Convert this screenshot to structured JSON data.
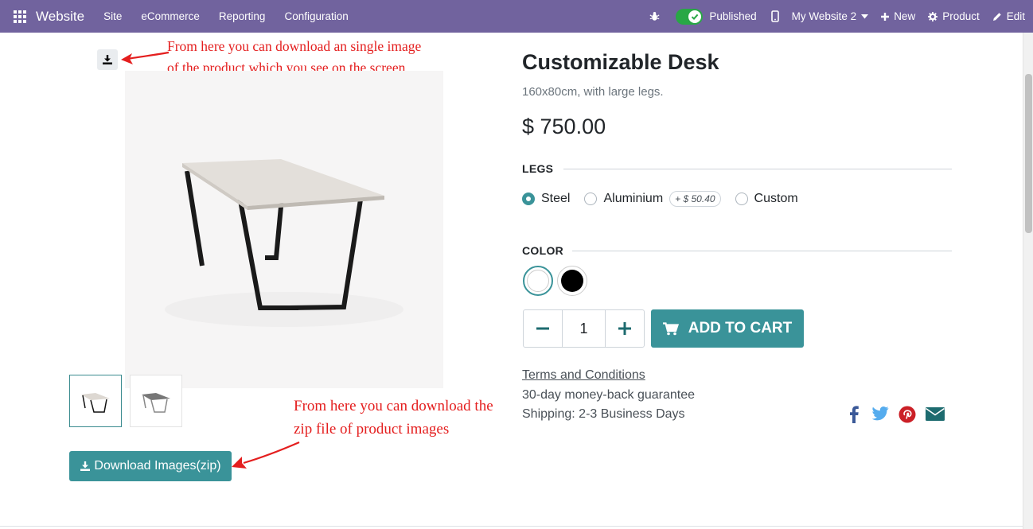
{
  "navbar": {
    "brand": "Website",
    "menu": [
      "Site",
      "eCommerce",
      "Reporting",
      "Configuration"
    ],
    "published_label": "Published",
    "website_selector": "My Website 2",
    "new_label": "New",
    "product_label": "Product",
    "edit_label": "Edit"
  },
  "annotations": {
    "single_download_line1": "From here you can download an single image",
    "single_download_line2": "of the product which you see on the screen",
    "zip_download_line1": "From here you can download the",
    "zip_download_line2": "zip file of product images"
  },
  "left": {
    "zip_button_label": "Download Images(zip)"
  },
  "product": {
    "name": "Customizable Desk",
    "description": "160x80cm, with large legs.",
    "price": "$ 750.00",
    "legs_label": "LEGS",
    "legs_options": [
      "Steel",
      "Aluminium",
      "Custom"
    ],
    "legs_selected": "Steel",
    "aluminium_extra": "+ $ 50.40",
    "color_label": "COLOR",
    "colors": [
      "#ffffff",
      "#000000"
    ],
    "selected_color": "#ffffff",
    "quantity": "1",
    "add_to_cart_label": "ADD TO CART",
    "terms_label": "Terms and Conditions",
    "guarantee": "30-day money-back guarantee",
    "shipping": "Shipping: 2-3 Business Days"
  },
  "colors": {
    "navbar": "#71639e",
    "primary": "#3a9399",
    "annotation": "#e41e1e",
    "facebook": "#3b5998",
    "twitter": "#55acee",
    "pinterest": "#cb2027",
    "email": "#1d6b6f"
  }
}
